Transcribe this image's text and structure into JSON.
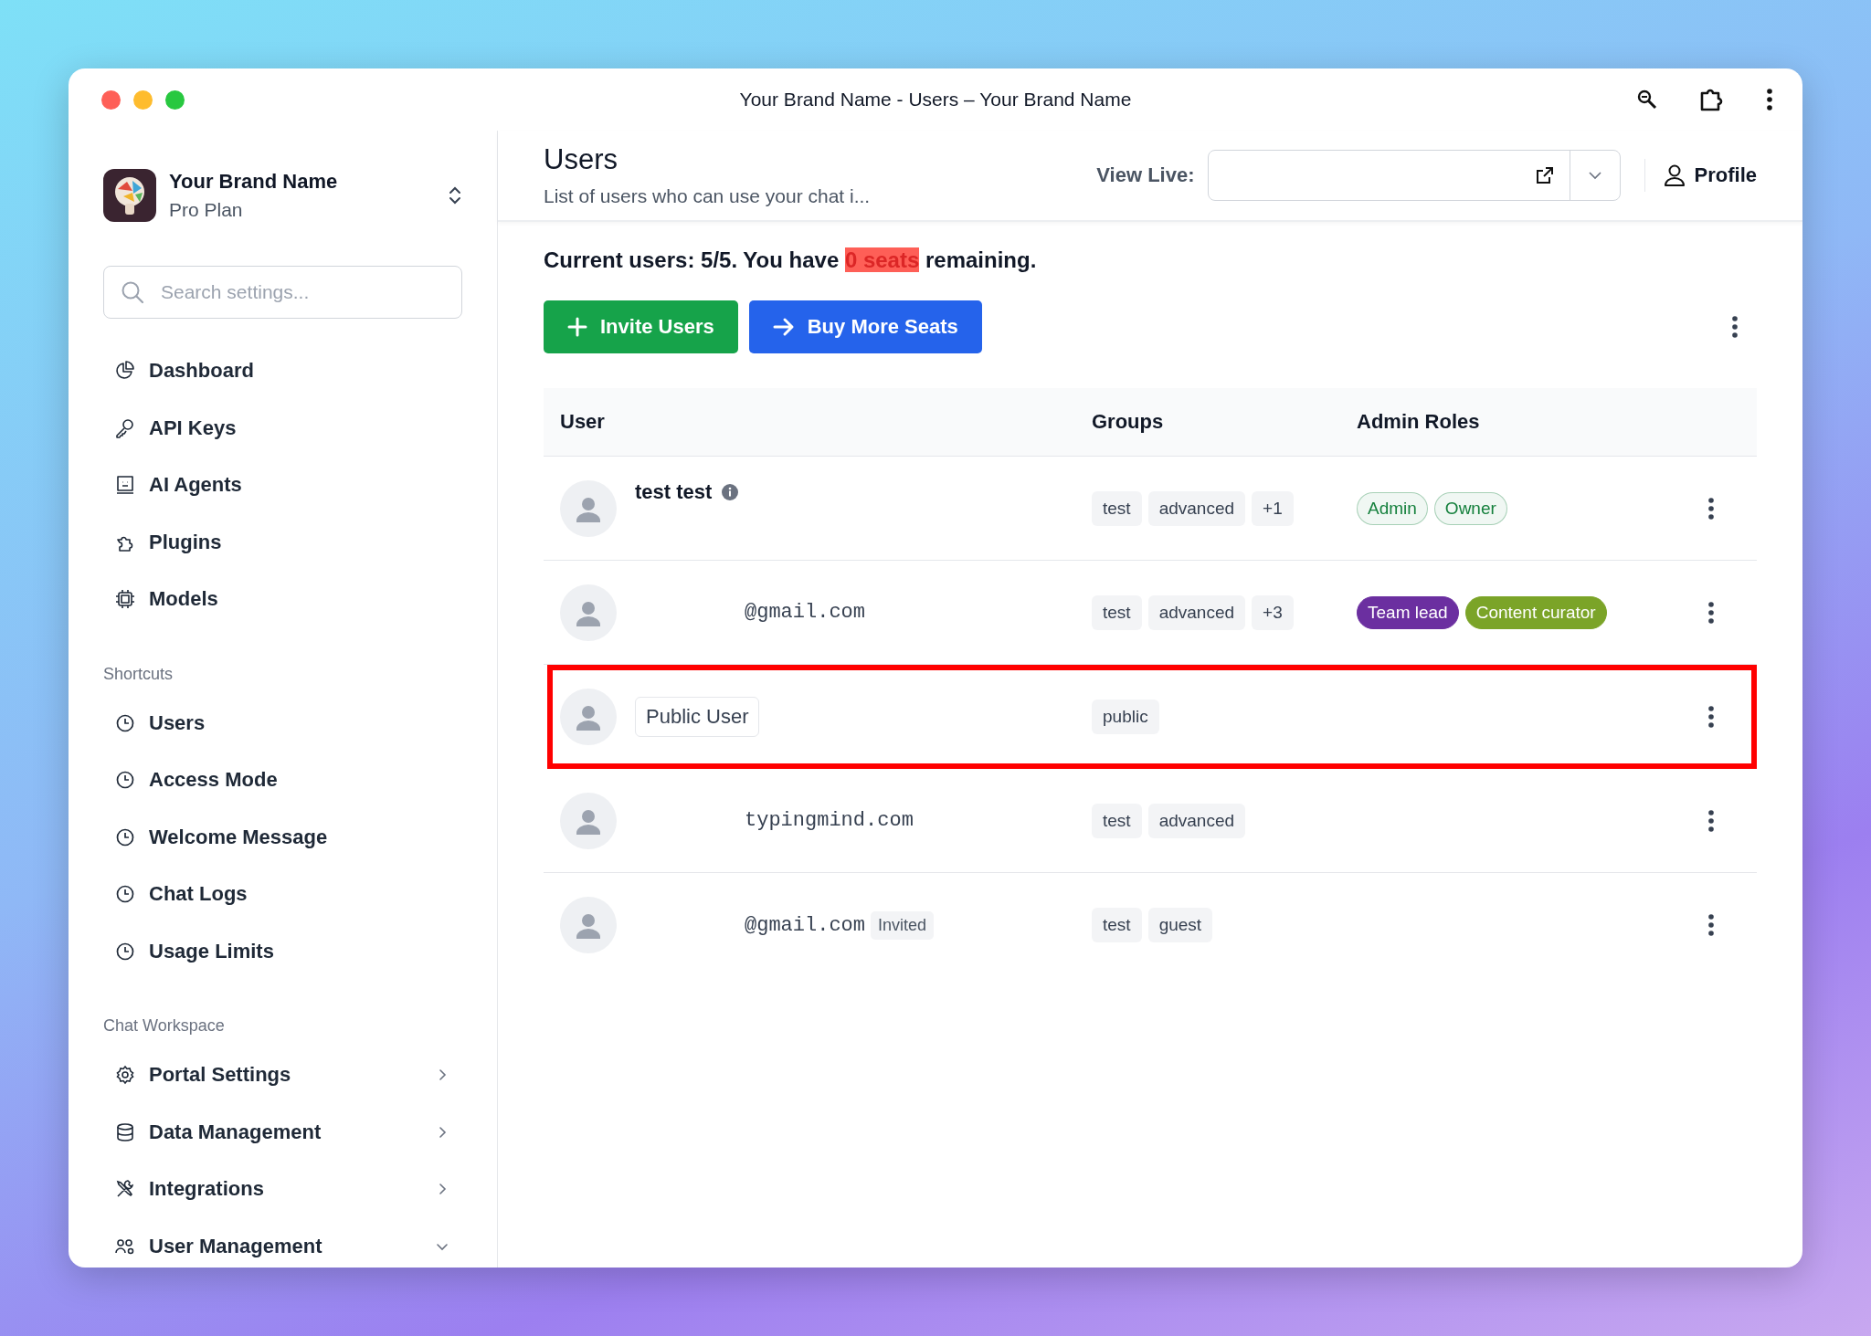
{
  "window": {
    "title": "Your Brand Name - Users – Your Brand Name"
  },
  "brand": {
    "name": "Your Brand Name",
    "plan": "Pro Plan"
  },
  "search": {
    "placeholder": "Search settings..."
  },
  "nav": [
    {
      "label": "Dashboard"
    },
    {
      "label": "API Keys"
    },
    {
      "label": "AI Agents"
    },
    {
      "label": "Plugins"
    },
    {
      "label": "Models"
    }
  ],
  "sections": [
    {
      "title": "Shortcuts",
      "items": [
        {
          "label": "Users"
        },
        {
          "label": "Access Mode"
        },
        {
          "label": "Welcome Message"
        },
        {
          "label": "Chat Logs"
        },
        {
          "label": "Usage Limits"
        }
      ]
    },
    {
      "title": "Chat Workspace",
      "items": [
        {
          "label": "Portal Settings",
          "expanded": false
        },
        {
          "label": "Data Management",
          "expanded": false
        },
        {
          "label": "Integrations",
          "expanded": false
        },
        {
          "label": "User Management",
          "expanded": true
        }
      ]
    }
  ],
  "header": {
    "title": "Users",
    "subtitle": "List of users who can use your chat i...",
    "view_live_label": "View Live:",
    "profile": "Profile"
  },
  "summary_parts": [
    "Current users: 5/5. You have ",
    "0 seats",
    " remaining."
  ],
  "buttons": [
    {
      "label": "Invite Users",
      "kind": "plus"
    },
    {
      "label": "Buy More Seats",
      "kind": "arrow"
    }
  ],
  "table": {
    "columns": [
      "User",
      "Groups",
      "Admin Roles"
    ],
    "rows": [
      {
        "user": "test test",
        "kind": "name",
        "info": true,
        "groups": [
          "test",
          "advanced",
          "+1"
        ],
        "roles": [
          {
            "label": "Admin",
            "kind": "outline",
            "color": "#15803d"
          },
          {
            "label": "Owner",
            "kind": "outline",
            "color": "#15803d"
          }
        ],
        "highlighted": false
      },
      {
        "user": "@gmail.com",
        "kind": "email",
        "groups": [
          "test",
          "advanced",
          "+3"
        ],
        "roles": [
          {
            "label": "Team lead",
            "kind": "solid",
            "color": "#6b2fa0"
          },
          {
            "label": "Content curator",
            "kind": "solid",
            "color": "#7ba428"
          }
        ],
        "highlighted": false
      },
      {
        "user": "Public User",
        "kind": "boxed",
        "groups": [
          "public"
        ],
        "roles": [],
        "highlighted": true
      },
      {
        "user": "typingmind.com",
        "kind": "email",
        "groups": [
          "test",
          "advanced"
        ],
        "roles": [],
        "highlighted": false
      },
      {
        "user": "@gmail.com",
        "kind": "email",
        "status": "Invited",
        "groups": [
          "test",
          "guest"
        ],
        "roles": [],
        "highlighted": false
      }
    ]
  }
}
